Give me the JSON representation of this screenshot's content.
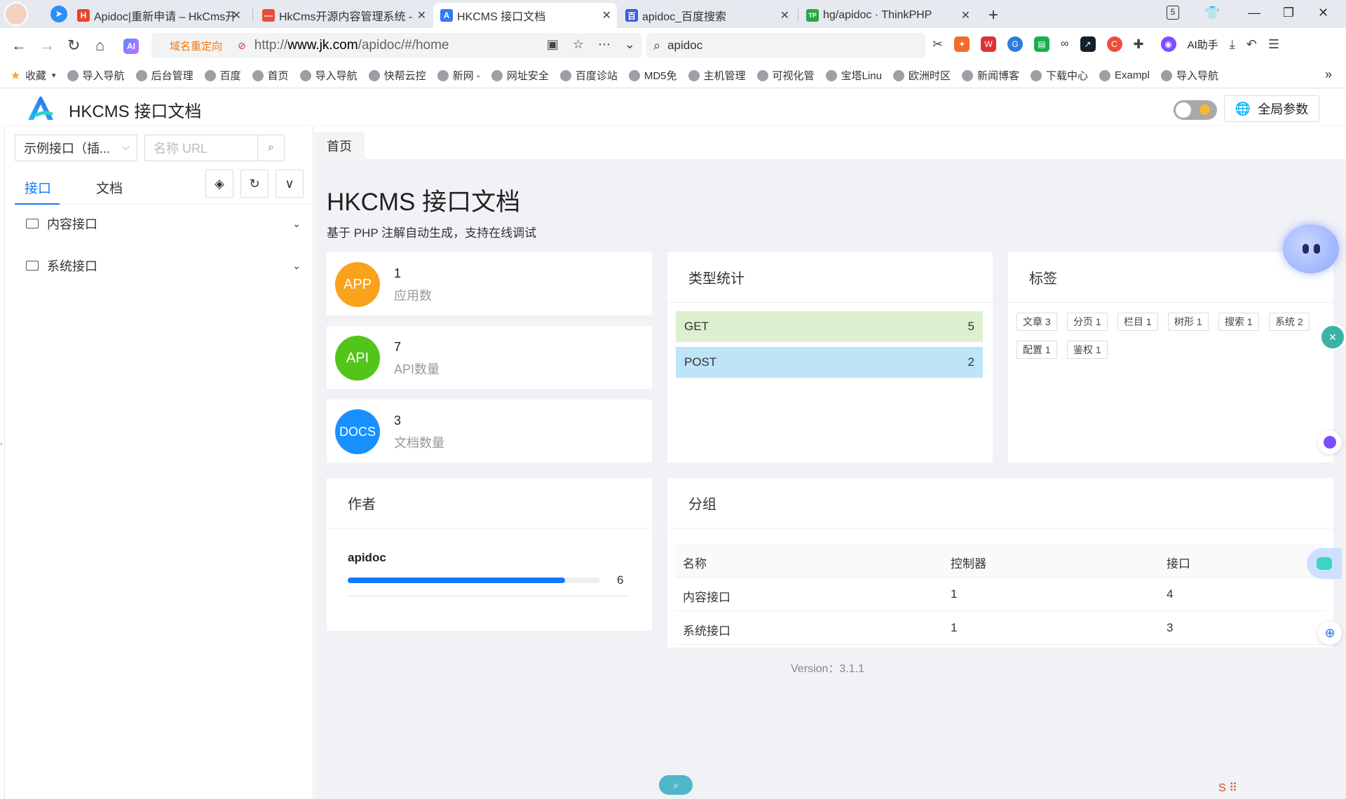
{
  "browser": {
    "tabs": [
      {
        "title": "Apidoc|重新申请 – HkCms开源内容",
        "icon_color": "#e8442a",
        "icon_text": "H"
      },
      {
        "title": "HkCms开源内容管理系统 -",
        "icon_color": "#e74c3c",
        "icon_text": "—"
      },
      {
        "title": "HKCMS 接口文档",
        "icon_color": "#2f7cf6",
        "icon_text": "A"
      },
      {
        "title": "apidoc_百度搜索",
        "icon_color": "#3a5bd9",
        "icon_text": "百"
      },
      {
        "title": "hg/apidoc · ThinkPHP",
        "icon_color": "#27a844",
        "icon_text": "TP"
      }
    ],
    "tab_counter": "5",
    "redirect_label": "域名重定向",
    "url_prefix": "http://",
    "url_domain": "www.jk.com",
    "url_path": "/apidoc/#/home",
    "search_query": "apidoc",
    "ai_assistant": "AI助手",
    "bookmarks": [
      "收藏",
      "导入导航",
      "后台管理",
      "百度",
      "首页",
      "导入导航",
      "快帮云控",
      "新网 -",
      "网址安全",
      "百度诊站",
      "MD5免",
      "主机管理",
      "可视化管",
      "宝塔Linu",
      "欧洲时区",
      "新闻博客",
      "下载中心",
      "Exampl",
      "导入导航"
    ],
    "bookmarks_more": "»"
  },
  "app": {
    "title": "HKCMS 接口文档",
    "global_params": "全局参数",
    "brand_color": "#1677ff"
  },
  "sidebar": {
    "select_value": "示例接口（插...",
    "search_placeholder": "名称 URL",
    "tabs": [
      "接口",
      "文档"
    ],
    "tree": [
      {
        "label": "内容接口"
      },
      {
        "label": "系统接口"
      }
    ]
  },
  "main": {
    "breadcrumb": "首页",
    "title": "HKCMS 接口文档",
    "subtitle": "基于 PHP 注解自动生成，支持在线调试",
    "stats": [
      {
        "badge": "APP",
        "value": "1",
        "label": "应用数",
        "color": "#faa21b"
      },
      {
        "badge": "API",
        "value": "7",
        "label": "API数量",
        "color": "#52c41a"
      },
      {
        "badge": "DOCS",
        "value": "3",
        "label": "文档数量",
        "color": "#1890ff"
      }
    ],
    "type_stats": {
      "heading": "类型统计",
      "rows": [
        {
          "method": "GET",
          "count": "5",
          "color": "#dcf0d0"
        },
        {
          "method": "POST",
          "count": "2",
          "color": "#bde4f7"
        }
      ]
    },
    "tags": {
      "heading": "标签",
      "items": [
        "文章 3",
        "分页 1",
        "栏目 1",
        "树形 1",
        "搜索 1",
        "系统 2",
        "配置 1",
        "鉴权 1"
      ]
    },
    "author": {
      "heading": "作者",
      "name": "apidoc",
      "count": "6",
      "progress": 0.86
    },
    "groups": {
      "heading": "分组",
      "columns": [
        "名称",
        "控制器",
        "接口"
      ],
      "rows": [
        [
          "内容接口",
          "1",
          "4"
        ],
        [
          "系统接口",
          "1",
          "3"
        ]
      ]
    },
    "version": "Version：3.1.1"
  }
}
